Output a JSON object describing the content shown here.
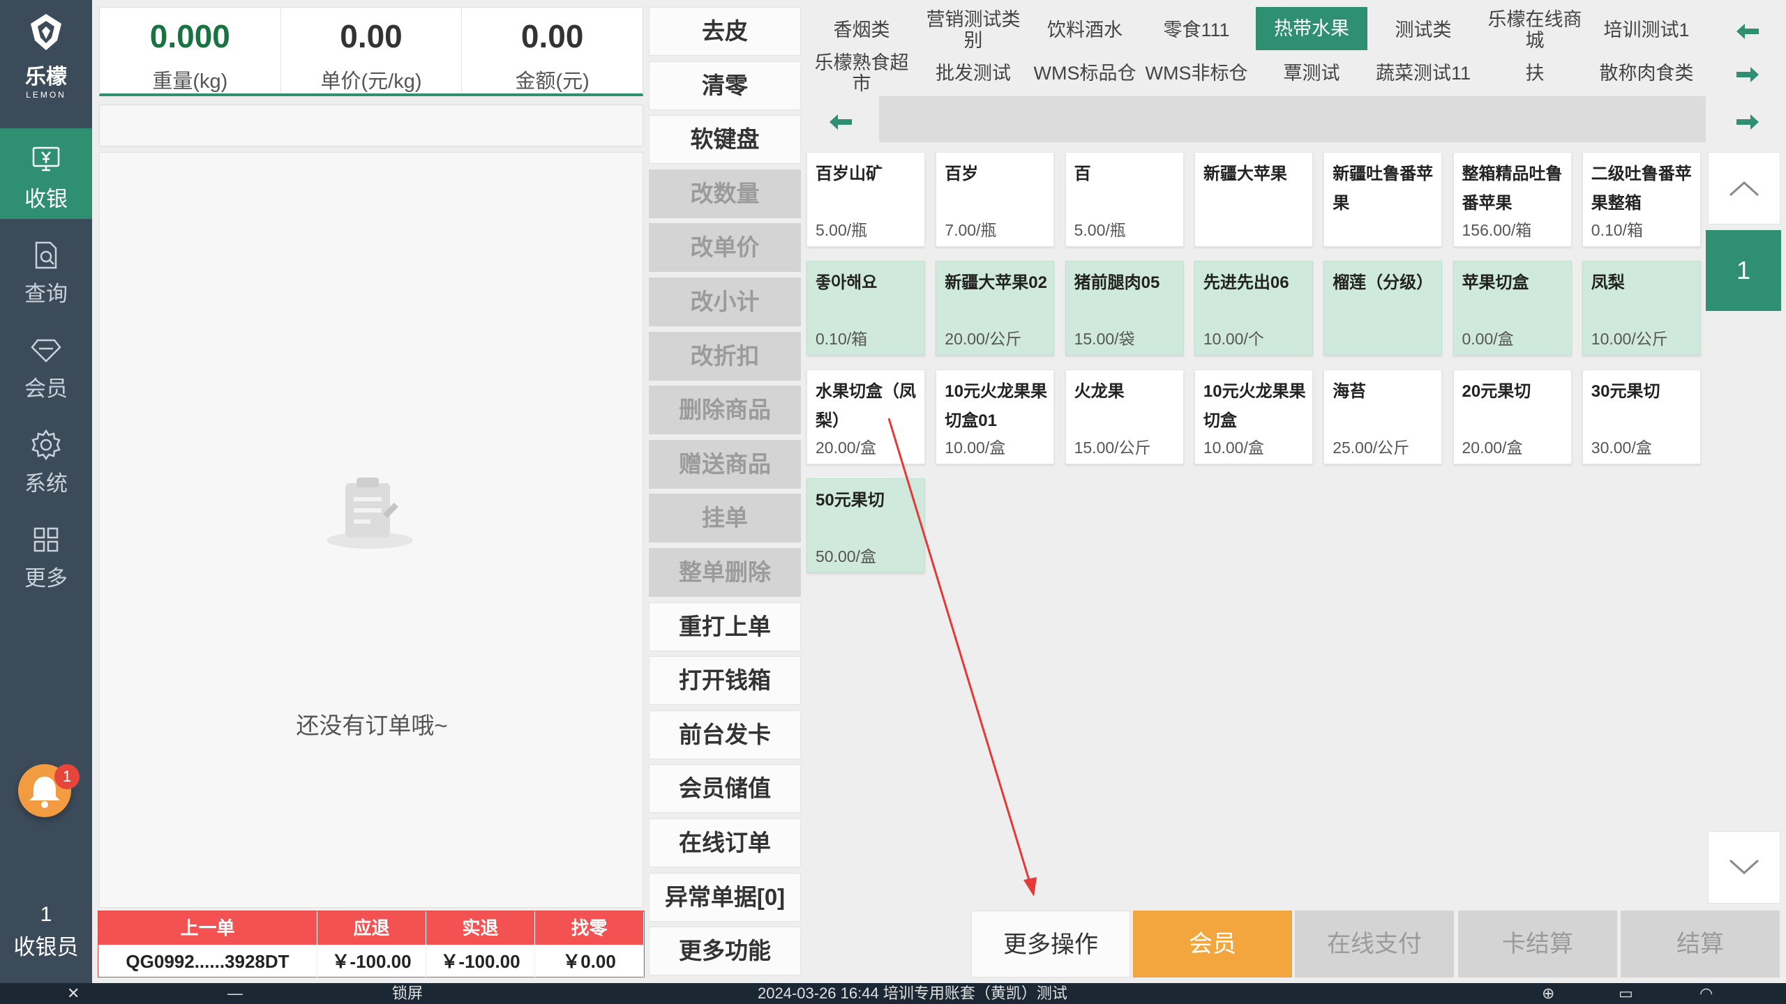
{
  "app": {
    "brand": "乐檬",
    "brand_en": "LEMON"
  },
  "sidebar": {
    "items": [
      {
        "label": "收银",
        "active": true
      },
      {
        "label": "查询"
      },
      {
        "label": "会员"
      },
      {
        "label": "系统"
      },
      {
        "label": "更多"
      }
    ],
    "notification_count": "1",
    "cashier_number": "1",
    "cashier_label": "收银员"
  },
  "scale": {
    "weight_value": "0.000",
    "weight_label": "重量(kg)",
    "price_value": "0.00",
    "price_label": "单价(元/kg)",
    "amount_value": "0.00",
    "amount_label": "金额(元)"
  },
  "order": {
    "empty_text": "还没有订单哦~"
  },
  "last_order": {
    "headers": [
      "上一单",
      "应退",
      "实退",
      "找零"
    ],
    "values": [
      "QG0992......3928DT",
      "￥-100.00",
      "￥-100.00",
      "￥0.00"
    ]
  },
  "functions": [
    {
      "label": "去皮",
      "disabled": false
    },
    {
      "label": "清零",
      "disabled": false
    },
    {
      "label": "软键盘",
      "disabled": false
    },
    {
      "label": "改数量",
      "disabled": true
    },
    {
      "label": "改单价",
      "disabled": true
    },
    {
      "label": "改小计",
      "disabled": true
    },
    {
      "label": "改折扣",
      "disabled": true
    },
    {
      "label": "删除商品",
      "disabled": true
    },
    {
      "label": "赠送商品",
      "disabled": true
    },
    {
      "label": "挂单",
      "disabled": true
    },
    {
      "label": "整单删除",
      "disabled": true
    },
    {
      "label": "重打上单",
      "disabled": false
    },
    {
      "label": "打开钱箱",
      "disabled": false
    },
    {
      "label": "前台发卡",
      "disabled": false
    },
    {
      "label": "会员储值",
      "disabled": false
    },
    {
      "label": "在线订单",
      "disabled": false
    },
    {
      "label": "异常单据[0]",
      "disabled": false
    },
    {
      "label": "更多功能",
      "disabled": false
    }
  ],
  "categories": {
    "row1": [
      "香烟类",
      "营销测试类别",
      "饮料酒水",
      "零食111",
      "热带水果",
      "测试类",
      "乐檬在线商城",
      "培训测试1"
    ],
    "row2": [
      "乐檬熟食超市",
      "批发测试",
      "WMS标品仓",
      "WMS非标仓",
      "覃测试",
      "蔬菜测试11",
      "扶",
      "散称肉食类"
    ],
    "active": "热带水果"
  },
  "products": [
    {
      "name": "百岁山矿",
      "price": "5.00/瓶",
      "green": false
    },
    {
      "name": "百岁",
      "price": "7.00/瓶",
      "green": false
    },
    {
      "name": "百",
      "price": "5.00/瓶",
      "green": false
    },
    {
      "name": "新疆大苹果",
      "price": "",
      "green": false
    },
    {
      "name": "新疆吐鲁番苹果",
      "price": "",
      "green": false
    },
    {
      "name": "整箱精品吐鲁番苹果",
      "price": "156.00/箱",
      "green": false
    },
    {
      "name": "二级吐鲁番苹果整箱",
      "price": "0.10/箱",
      "green": false
    },
    {
      "name": "좋아해요",
      "price": "0.10/箱",
      "green": true
    },
    {
      "name": "新疆大苹果02",
      "price": "20.00/公斤",
      "green": true
    },
    {
      "name": "猪前腿肉05",
      "price": "15.00/袋",
      "green": true
    },
    {
      "name": "先进先出06",
      "price": "10.00/个",
      "green": true
    },
    {
      "name": "榴莲（分级）",
      "price": "",
      "green": true
    },
    {
      "name": "苹果切盒",
      "price": "0.00/盒",
      "green": true
    },
    {
      "name": "凤梨",
      "price": "10.00/公斤",
      "green": true
    },
    {
      "name": "水果切盒（凤梨）",
      "price": "20.00/盒",
      "green": false
    },
    {
      "name": "10元火龙果果切盒01",
      "price": "10.00/盒",
      "green": false
    },
    {
      "name": "火龙果",
      "price": "15.00/公斤",
      "green": false
    },
    {
      "name": "10元火龙果果切盒",
      "price": "10.00/盒",
      "green": false
    },
    {
      "name": "海苔",
      "price": "25.00/公斤",
      "green": false
    },
    {
      "name": "20元果切",
      "price": "20.00/盒",
      "green": false
    },
    {
      "name": "30元果切",
      "price": "30.00/盒",
      "green": false
    },
    {
      "name": "50元果切",
      "price": "50.00/盒",
      "green": true
    }
  ],
  "pager": {
    "current_page": "1"
  },
  "actions": {
    "more": "更多操作",
    "member": "会员",
    "online_pay": "在线支付",
    "card_settle": "卡结算",
    "settle": "结算"
  },
  "statusbar": {
    "lock": "锁屏",
    "info": "2024-03-26 16:44 培训专用账套（黄凯）测试"
  },
  "colors": {
    "accent": "#2e9070",
    "sidebar": "#3c4b5a",
    "member": "#f3a53e",
    "header_red": "#f45252",
    "annotation": "#e53935"
  }
}
